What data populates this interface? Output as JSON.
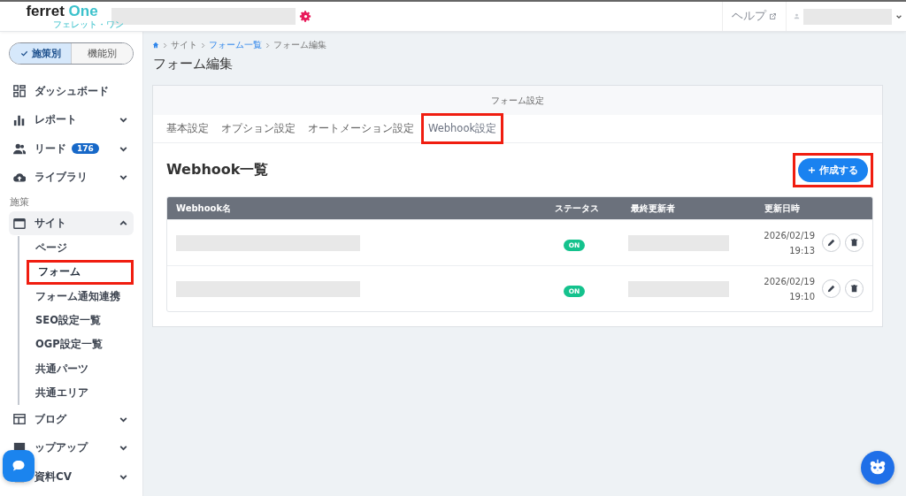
{
  "header": {
    "logo": {
      "main": "ferret",
      "accent": "One",
      "sub": "フェレット・ワン"
    },
    "help": "ヘルプ"
  },
  "sidebar": {
    "toggle": [
      {
        "label": "施策別",
        "selected": true
      },
      {
        "label": "機能別",
        "selected": false
      }
    ],
    "items": [
      {
        "label": "ダッシュボード"
      },
      {
        "label": "レポート",
        "expanded": false
      },
      {
        "label": "リード",
        "badge": "176",
        "expanded": false
      },
      {
        "label": "ライブラリ",
        "expanded": false
      }
    ],
    "section": "施策",
    "group": {
      "label": "サイト",
      "expanded": true,
      "children": [
        {
          "label": "ページ",
          "selected": false,
          "highlighted": false
        },
        {
          "label": "フォーム",
          "selected": true,
          "highlighted": true
        },
        {
          "label": "フォーム通知連携",
          "selected": false,
          "highlighted": false
        },
        {
          "label": "SEO設定一覧",
          "selected": false,
          "highlighted": false
        },
        {
          "label": "OGP設定一覧",
          "selected": false,
          "highlighted": false
        },
        {
          "label": "共通パーツ",
          "selected": false,
          "highlighted": false
        },
        {
          "label": "共通エリア",
          "selected": false,
          "highlighted": false
        }
      ]
    },
    "more": [
      {
        "label": "ブログ",
        "expanded": false
      },
      {
        "label": "ップアップ",
        "expanded": false
      },
      {
        "label": "資料CV",
        "expanded": false
      }
    ]
  },
  "breadcrumb": [
    {
      "label": "サイト",
      "link": false
    },
    {
      "label": "フォーム一覧",
      "link": true
    },
    {
      "label": "フォーム編集",
      "link": false
    }
  ],
  "page_title": "フォーム編集",
  "card": {
    "header": "フォーム設定",
    "tabs": [
      {
        "label": "基本設定",
        "selected": false,
        "highlighted": false
      },
      {
        "label": "オプション設定",
        "selected": false,
        "highlighted": false
      },
      {
        "label": "オートメーション設定",
        "selected": false,
        "highlighted": false
      },
      {
        "label": "Webhook設定",
        "selected": true,
        "highlighted": true
      }
    ],
    "title": "Webhook一覧",
    "create_button": {
      "label": "作成する",
      "highlighted": true
    },
    "table": {
      "columns": [
        "Webhook名",
        "ステータス",
        "最終更新者",
        "更新日時"
      ],
      "rows": [
        {
          "status": "ON",
          "date": "2026/02/19",
          "time": "19:13"
        },
        {
          "status": "ON",
          "date": "2026/02/19",
          "time": "19:10"
        }
      ]
    }
  }
}
